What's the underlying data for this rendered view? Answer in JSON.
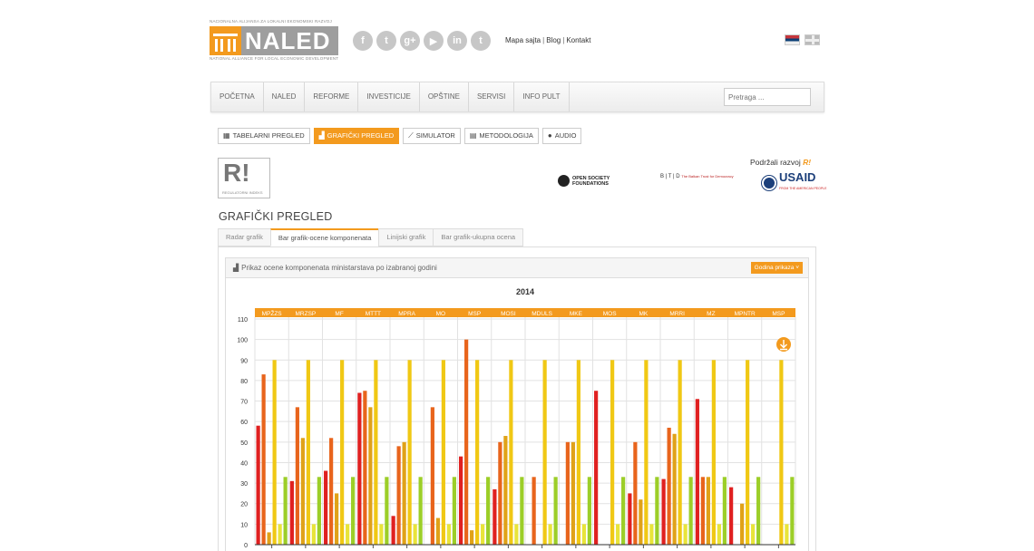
{
  "header": {
    "org_top": "NACIONALNA ALIJANSA ZA LOKALNI EKONOMSKI RAZVOJ",
    "org_name": "NALED",
    "org_bottom": "NATIONAL ALLIANCE FOR LOCAL ECONOMIC DEVELOPMENT",
    "social": [
      {
        "name": "facebook-icon",
        "glyph": "f"
      },
      {
        "name": "twitter-icon",
        "glyph": "t"
      },
      {
        "name": "google-plus-icon",
        "glyph": "g+"
      },
      {
        "name": "youtube-icon",
        "glyph": "▶"
      },
      {
        "name": "linkedin-icon",
        "glyph": "in"
      },
      {
        "name": "twitter-icon-2",
        "glyph": "t"
      }
    ],
    "links": [
      "Mapa sajta",
      "Blog",
      "Kontakt"
    ]
  },
  "nav": {
    "items": [
      "POČETNA",
      "NALED",
      "REFORME",
      "INVESTICIJE",
      "OPŠTINE",
      "SERVISI",
      "INFO PULT"
    ],
    "search_placeholder": "Pretraga ..."
  },
  "subtabs": [
    {
      "label": "TABELARNI PREGLED",
      "icon": "table-icon",
      "glyph": "▦",
      "active": false
    },
    {
      "label": "GRAFIČKI PREGLED",
      "icon": "chart-icon",
      "glyph": "▟",
      "active": true
    },
    {
      "label": "SIMULATOR",
      "icon": "line-chart-icon",
      "glyph": "⟋",
      "active": false
    },
    {
      "label": "METODOLOGIJA",
      "icon": "doc-icon",
      "glyph": "▤",
      "active": false
    },
    {
      "label": "AUDIO",
      "icon": "mic-icon",
      "glyph": "●",
      "active": false
    }
  ],
  "sponsors": {
    "ri_logo": "R!",
    "ri_small": "REGULATORNI INDEKS",
    "podrzali": "Podržali razvoj",
    "podrzali_mark": "R!",
    "osf": "OPEN SOCIETY FOUNDATIONS",
    "btd": "B | T | D",
    "btd_text": "The Balkan Trust for Democracy",
    "usaid": "USAID",
    "usaid_sub": "FROM THE AMERICAN PEOPLE"
  },
  "page_title": "GRAFIČKI PREGLED",
  "chart_tabs": [
    {
      "label": "Radar grafik",
      "active": false
    },
    {
      "label": "Bar grafik-ocene komponenata",
      "active": true
    },
    {
      "label": "Linijski grafik",
      "active": false
    },
    {
      "label": "Bar grafik-ukupna ocena",
      "active": false
    }
  ],
  "panel": {
    "title": "Prikaz ocene komponenata ministarstava po izabranoj godini",
    "button": "Godina prikaza ˅"
  },
  "colors": {
    "accent": "#f39a1e",
    "series": [
      "#e02020",
      "#e8641c",
      "#e0a218",
      "#f0c814",
      "#e8e43a",
      "#9cce28"
    ]
  },
  "chart_data": {
    "type": "bar",
    "title": "2014",
    "categories": [
      "MPŽZS",
      "MRZSP",
      "MF",
      "MTTT",
      "MPRA",
      "MO",
      "MSP",
      "MOSI",
      "MDULS",
      "MKE",
      "MOS",
      "MK",
      "MRRI",
      "MZ",
      "MPNTR",
      "MSP"
    ],
    "ylim": [
      0,
      110
    ],
    "yticks": [
      0,
      10,
      20,
      30,
      40,
      50,
      60,
      70,
      80,
      90,
      100,
      110
    ],
    "series": [
      {
        "values": [
          58,
          31,
          36,
          74,
          14,
          0,
          43,
          27,
          0,
          0,
          75,
          25,
          32,
          71,
          28,
          0
        ]
      },
      {
        "values": [
          83,
          67,
          52,
          75,
          48,
          67,
          100,
          50,
          33,
          50,
          0,
          50,
          57,
          33,
          0,
          0
        ]
      },
      {
        "values": [
          6,
          52,
          25,
          67,
          50,
          13,
          7,
          53,
          0,
          50,
          0,
          22,
          54,
          33,
          20,
          0
        ]
      },
      {
        "values": [
          90,
          90,
          90,
          90,
          90,
          90,
          90,
          90,
          90,
          90,
          90,
          90,
          90,
          90,
          90,
          90
        ]
      },
      {
        "values": [
          10,
          10,
          10,
          10,
          10,
          10,
          10,
          10,
          10,
          10,
          10,
          10,
          10,
          10,
          10,
          10
        ]
      },
      {
        "values": [
          33,
          33,
          33,
          33,
          33,
          33,
          33,
          33,
          33,
          33,
          33,
          33,
          33,
          33,
          33,
          33
        ]
      }
    ]
  }
}
